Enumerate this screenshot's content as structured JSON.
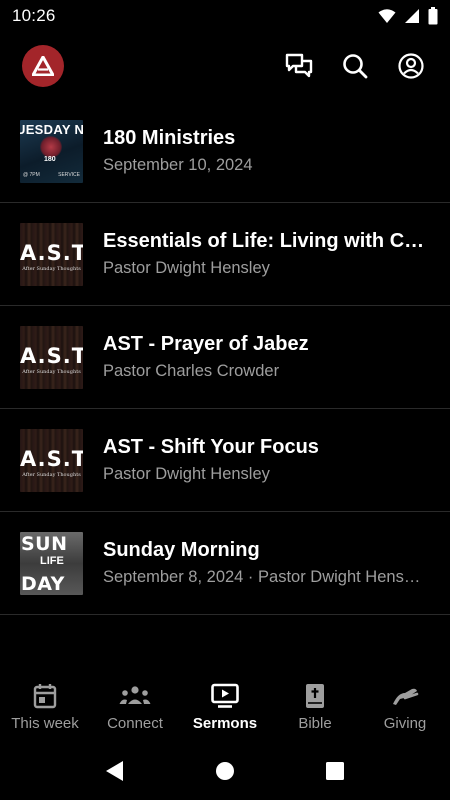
{
  "status_bar": {
    "time": "10:26"
  },
  "colors": {
    "background": "#000000",
    "logo_red": "#a3252a",
    "secondary_text": "#9e9e9e",
    "divider": "#2a2a2a"
  },
  "header": {
    "logo_icon": "app-logo-triangle",
    "actions": [
      "chat-icon",
      "search-icon",
      "account-icon"
    ]
  },
  "sermons": [
    {
      "title": "180 Ministries",
      "subtitle": "September 10, 2024",
      "thumbnail": {
        "line1": "UESDAY NIGHT",
        "line2": "180",
        "left": "@ 7PM",
        "right": "SERVICE"
      }
    },
    {
      "title": "Essentials of Life: Living with Co…",
      "subtitle": "Pastor Dwight Hensley",
      "thumbnail": {
        "line1": "A.S.T",
        "line2": "After Sunday Thoughts"
      }
    },
    {
      "title": "AST - Prayer of Jabez",
      "subtitle": "Pastor Charles Crowder",
      "thumbnail": {
        "line1": "A.S.T",
        "line2": "After Sunday Thoughts"
      }
    },
    {
      "title": "AST - Shift Your Focus",
      "subtitle": "Pastor Dwight Hensley",
      "thumbnail": {
        "line1": "A.S.T",
        "line2": "After Sunday Thoughts"
      }
    },
    {
      "title": "Sunday Morning",
      "subtitle": "September 8, 2024 · Pastor Dwight Hens…",
      "thumbnail": {
        "line1": "SUN",
        "line2": "LIFE",
        "line3": "DAY"
      }
    }
  ],
  "bottom_nav": [
    {
      "label": "This week",
      "icon": "calendar-icon",
      "active": false
    },
    {
      "label": "Connect",
      "icon": "people-icon",
      "active": false
    },
    {
      "label": "Sermons",
      "icon": "video-icon",
      "active": true
    },
    {
      "label": "Bible",
      "icon": "bible-icon",
      "active": false
    },
    {
      "label": "Giving",
      "icon": "giving-hand-icon",
      "active": false
    }
  ]
}
